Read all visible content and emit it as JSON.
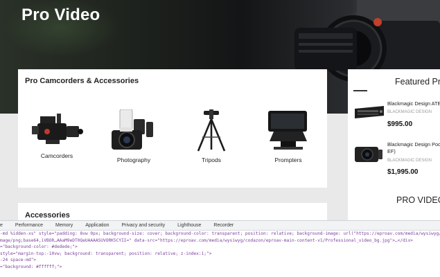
{
  "hero": {
    "title": "Pro Video"
  },
  "categories_card": {
    "title": "Pro Camcorders & Accessories",
    "items": [
      {
        "label": "Camcorders",
        "icon": "camcorder-icon"
      },
      {
        "label": "Photography",
        "icon": "dslr-camera-icon"
      },
      {
        "label": "Tripods",
        "icon": "tripod-icon"
      },
      {
        "label": "Prompters",
        "icon": "teleprompter-icon"
      }
    ]
  },
  "accessories_card": {
    "title": "Accessories"
  },
  "featured": {
    "title": "Featured Pr",
    "products": [
      {
        "name": "Blackmagic Design ATE",
        "brand": "BLACKMAGIC DESIGN",
        "price": "$995.00"
      },
      {
        "name": "Blackmagic Design Pock",
        "name2": "EF)",
        "brand": "BLACKMAGIC DESIGN",
        "price": "$1,995.00"
      }
    ],
    "pro_video_heading": "PRO VIDEO"
  },
  "devtools": {
    "tabs": [
      "e",
      "Performance",
      "Memory",
      "Application",
      "Privacy and security",
      "Lighthouse",
      "Recorder"
    ],
    "lines": [
      "-md %idden-xs\" style=\"padding: 8vw 0px; background-size: cover; background-color: transparent; position: relative; background-image: url(\"https://eproav.com/media/wysiwyg/codazo",
      "mage/png;base64,iVBOR…AAaM9eDT0QeUAAAASUVORK5CYII=\" data-src=\"https://eproav.com/media/wysiwyg/codazon/eproav-main-content-v1/Professional_video_bg.jpg\">…</div>",
      "=\"background-color: #dedede;\">",
      "style=\"margin-top:-10vw; background: transparent; position: relative; z-index:1;\">",
      "",
      "-24 space-md\">",
      "=\"background: #ffffff;\">"
    ]
  }
}
